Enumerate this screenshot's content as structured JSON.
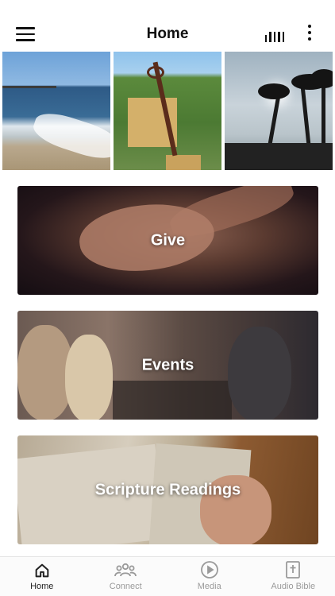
{
  "header": {
    "title": "Home"
  },
  "cards": [
    {
      "label": "Give"
    },
    {
      "label": "Events"
    },
    {
      "label": "Scripture Readings"
    }
  ],
  "tabs": [
    {
      "label": "Home",
      "icon": "home-icon",
      "active": true
    },
    {
      "label": "Connect",
      "icon": "people-icon",
      "active": false
    },
    {
      "label": "Media",
      "icon": "play-icon",
      "active": false
    },
    {
      "label": "Audio Bible",
      "icon": "bible-icon",
      "active": false
    }
  ],
  "colors": {
    "active_tab": "#222222",
    "inactive_tab": "#9a9a9a"
  }
}
